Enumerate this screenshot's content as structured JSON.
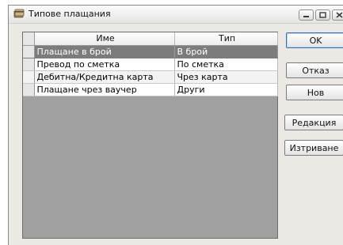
{
  "window": {
    "title": "Типове плащания",
    "icon": "payment-card-icon"
  },
  "grid": {
    "columns": [
      "Име",
      "Тип"
    ],
    "rows": [
      {
        "name": "Плащане в брой",
        "type": "В брой",
        "selected": true
      },
      {
        "name": "Превод по сметка",
        "type": "По сметка",
        "selected": false
      },
      {
        "name": "Дебитна/Кредитна карта",
        "type": "Чрез карта",
        "selected": false
      },
      {
        "name": "Плащане чрез ваучер",
        "type": "Други",
        "selected": false
      }
    ]
  },
  "buttons": {
    "ok": "OK",
    "cancel": "Отказ",
    "new": "Нов",
    "edit": "Редакция",
    "delete": "Изтриване"
  },
  "colors": {
    "selected_row": "#7c7c7c",
    "grid_background": "#a0a0a0",
    "window_background": "#ece9e4"
  }
}
